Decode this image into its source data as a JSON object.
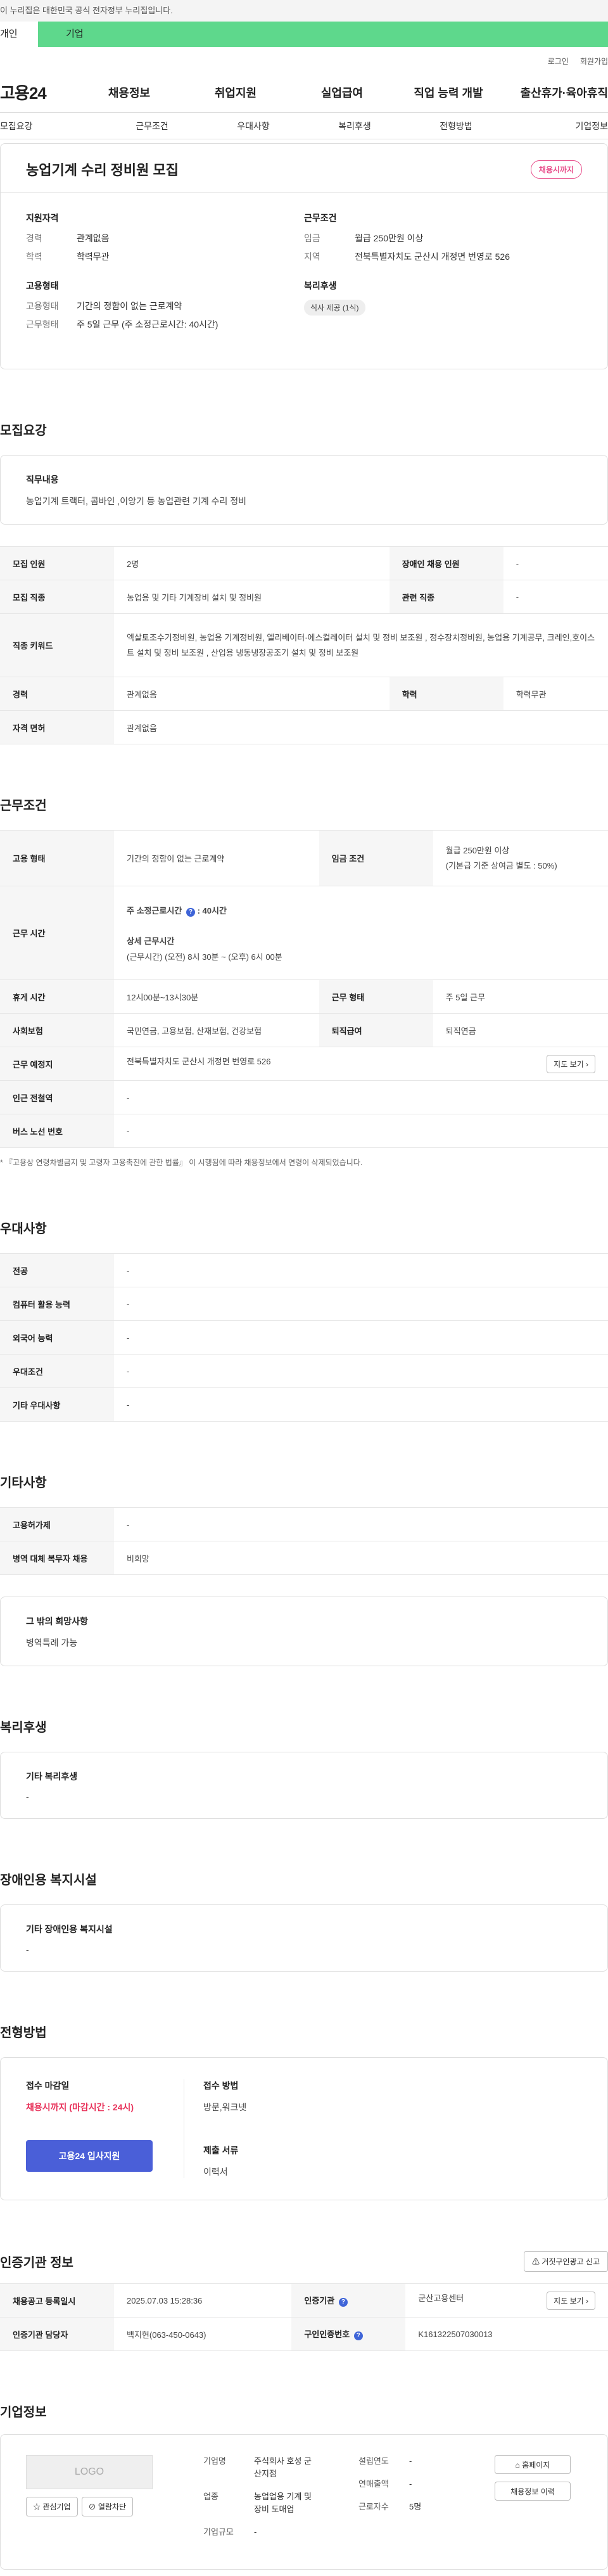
{
  "gov_banner": "이 누리집은 대한민국 공식 전자정부 누리집입니다.",
  "user_tabs": {
    "personal": "개인",
    "corporate": "기업"
  },
  "top_links": [
    "로그인",
    "회원가입"
  ],
  "site": {
    "logo": "고용24"
  },
  "gnb": [
    "채용정보",
    "취업지원",
    "실업급여",
    "직업 능력 개발",
    "출산휴가·육아휴직"
  ],
  "snb": [
    "모집요강",
    "근무조건",
    "우대사항",
    "복리후생",
    "전형방법",
    "기업정보"
  ],
  "summary": {
    "title": "농업기계 수리 정비원 모집",
    "status_badge": "채용시까지",
    "qual_title": "지원자격",
    "qual": [
      {
        "k": "경력",
        "v": "관계없음"
      },
      {
        "k": "학력",
        "v": "학력무관"
      }
    ],
    "emp_title": "고용형태",
    "emp": [
      {
        "k": "고용형태",
        "v": "기간의 정함이 없는 근로계약"
      },
      {
        "k": "근무형태",
        "v": "주 5일 근무 (주 소정근로시간: 40시간)"
      }
    ],
    "cond_title": "근무조건",
    "cond": [
      {
        "k": "임금",
        "v": "월급 250만원 이상"
      },
      {
        "k": "지역",
        "v": "전북특별자치도 군산시 개정면 번영로 526"
      }
    ],
    "welfare_title": "복리후생",
    "welfare_chip": "식사 제공 (1식)"
  },
  "recruit": {
    "title": "모집요강",
    "duty_title": "직무내용",
    "duty_text": "농업기계 트랙터, 콤바인 ,이앙기 등 농업관련 기계 수리 정비",
    "rows": {
      "r1": [
        "모집 인원",
        "2명",
        "장애인 채용 인원",
        "-"
      ],
      "r2": [
        "모집 직종",
        "농업용 및 기타 기계장비 설치 및 정비원",
        "관련 직종",
        "-"
      ],
      "r3_label": "직종 키워드",
      "r3_value": "엑살토조수기정비원, 농업용 기계정비원, 엘리베이터·에스컬레이터 설치 및 정비 보조원 , 정수장치정비원, 농업용 기계공무, 크레인,호이스트 설치 및 정비 보조원 , 산업용 냉동냉장공조기 설치 및 정비 보조원",
      "r4": [
        "경력",
        "관계없음",
        "학력",
        "학력무관"
      ],
      "r5": [
        "자격 면허",
        "관계없음"
      ]
    }
  },
  "work": {
    "title": "근무조건",
    "r1": [
      "고용 형태",
      "기간의 정함이 없는 근로계약",
      "임금 조건",
      "월급 250만원 이상",
      "(기본급 기준 상여금 별도 : 50%)"
    ],
    "hours_label": "근무 시간",
    "hours_weekly_label": "주 소정근로시간",
    "hours_weekly_value": ": 40시간",
    "hours_detail_label": "상세 근무시간",
    "hours_detail_value": "(근무시간) (오전) 8시 30분 ~ (오후) 6시 00분",
    "r3": [
      "휴게 시간",
      "12시00분~13시30분",
      "근무 형태",
      "주 5일 근무"
    ],
    "r4": [
      "사회보험",
      "국민연금, 고용보험, 산재보험, 건강보험",
      "퇴직급여",
      "퇴직연금"
    ],
    "r5": [
      "근무 예정지",
      "전북특별자치도 군산시 개정면 번영로 526"
    ],
    "map_button": "지도 보기",
    "r6": [
      "인근 전철역",
      "-"
    ],
    "r7": [
      "버스 노선 번호",
      "-"
    ],
    "note": "* 『고용상 연령차별금지 및 고령자 고용촉진에 관한 법률』 이 시행됨에 따라 채용정보에서 연령이 삭제되었습니다."
  },
  "pref": {
    "title": "우대사항",
    "rows": [
      [
        "전공",
        "-"
      ],
      [
        "컴퓨터 활용 능력",
        "-"
      ],
      [
        "외국어 능력",
        "-"
      ],
      [
        "우대조건",
        "-"
      ],
      [
        "기타 우대사항",
        "-"
      ]
    ]
  },
  "etc": {
    "title": "기타사항",
    "rows": [
      [
        "고용허가제",
        "-"
      ],
      [
        "병역 대체 복무자 채용",
        "비희망"
      ]
    ],
    "box_title": "그 밖의 희망사항",
    "box_text": "병역특례 가능"
  },
  "benefit": {
    "title": "복리후생",
    "box_title": "기타 복리후생",
    "box_text": "-"
  },
  "disabled": {
    "title": "장애인용 복지시설",
    "box_title": "기타 장애인용 복지시설",
    "box_text": "-"
  },
  "screening": {
    "title": "전형방법",
    "deadline_title": "접수 마감일",
    "deadline": "채용시까지 (마감시간 : 24시)",
    "apply_button": "고용24 입사지원",
    "method_title": "접수 방법",
    "method": "방문,워크넷",
    "docs_title": "제출 서류",
    "docs": "이력서"
  },
  "cert": {
    "title": "인증기관 정보",
    "report_button": "거짓구인광고 신고",
    "r1": [
      "채용공고 등록일시",
      "2025.07.03 15:28:36",
      "인증기관",
      "군산고용센터"
    ],
    "map_button": "지도 보기",
    "r2": [
      "인증기관 담당자",
      "백지현(063-450-0643)",
      "구인인증번호",
      "K161322507030013"
    ]
  },
  "company": {
    "title": "기업정보",
    "logo_placeholder": "LOGO",
    "interest_button": "관심기업",
    "block_button": "열람차단",
    "fields_col1": [
      [
        "기업명",
        "주식회사 호성 군산지점"
      ],
      [
        "업종",
        "농업업용 기계 및 장비 도매업"
      ],
      [
        "기업규모",
        "-"
      ]
    ],
    "fields_col2": [
      [
        "설립연도",
        "-"
      ],
      [
        "연매출액",
        "-"
      ],
      [
        "근로자수",
        "5명"
      ]
    ],
    "homepage_button": "홈페이지",
    "history_button": "채용정보 이력"
  },
  "icons": {
    "info": "info-icon",
    "map": "map-icon",
    "home": "home-icon",
    "star": "star-icon",
    "block": "block-icon",
    "report": "report-icon"
  },
  "colors": {
    "corp_tab": "#5ed88c",
    "badge": "#e84d8a",
    "deadline": "#e8335b",
    "apply_button": "#4a5fd8"
  }
}
